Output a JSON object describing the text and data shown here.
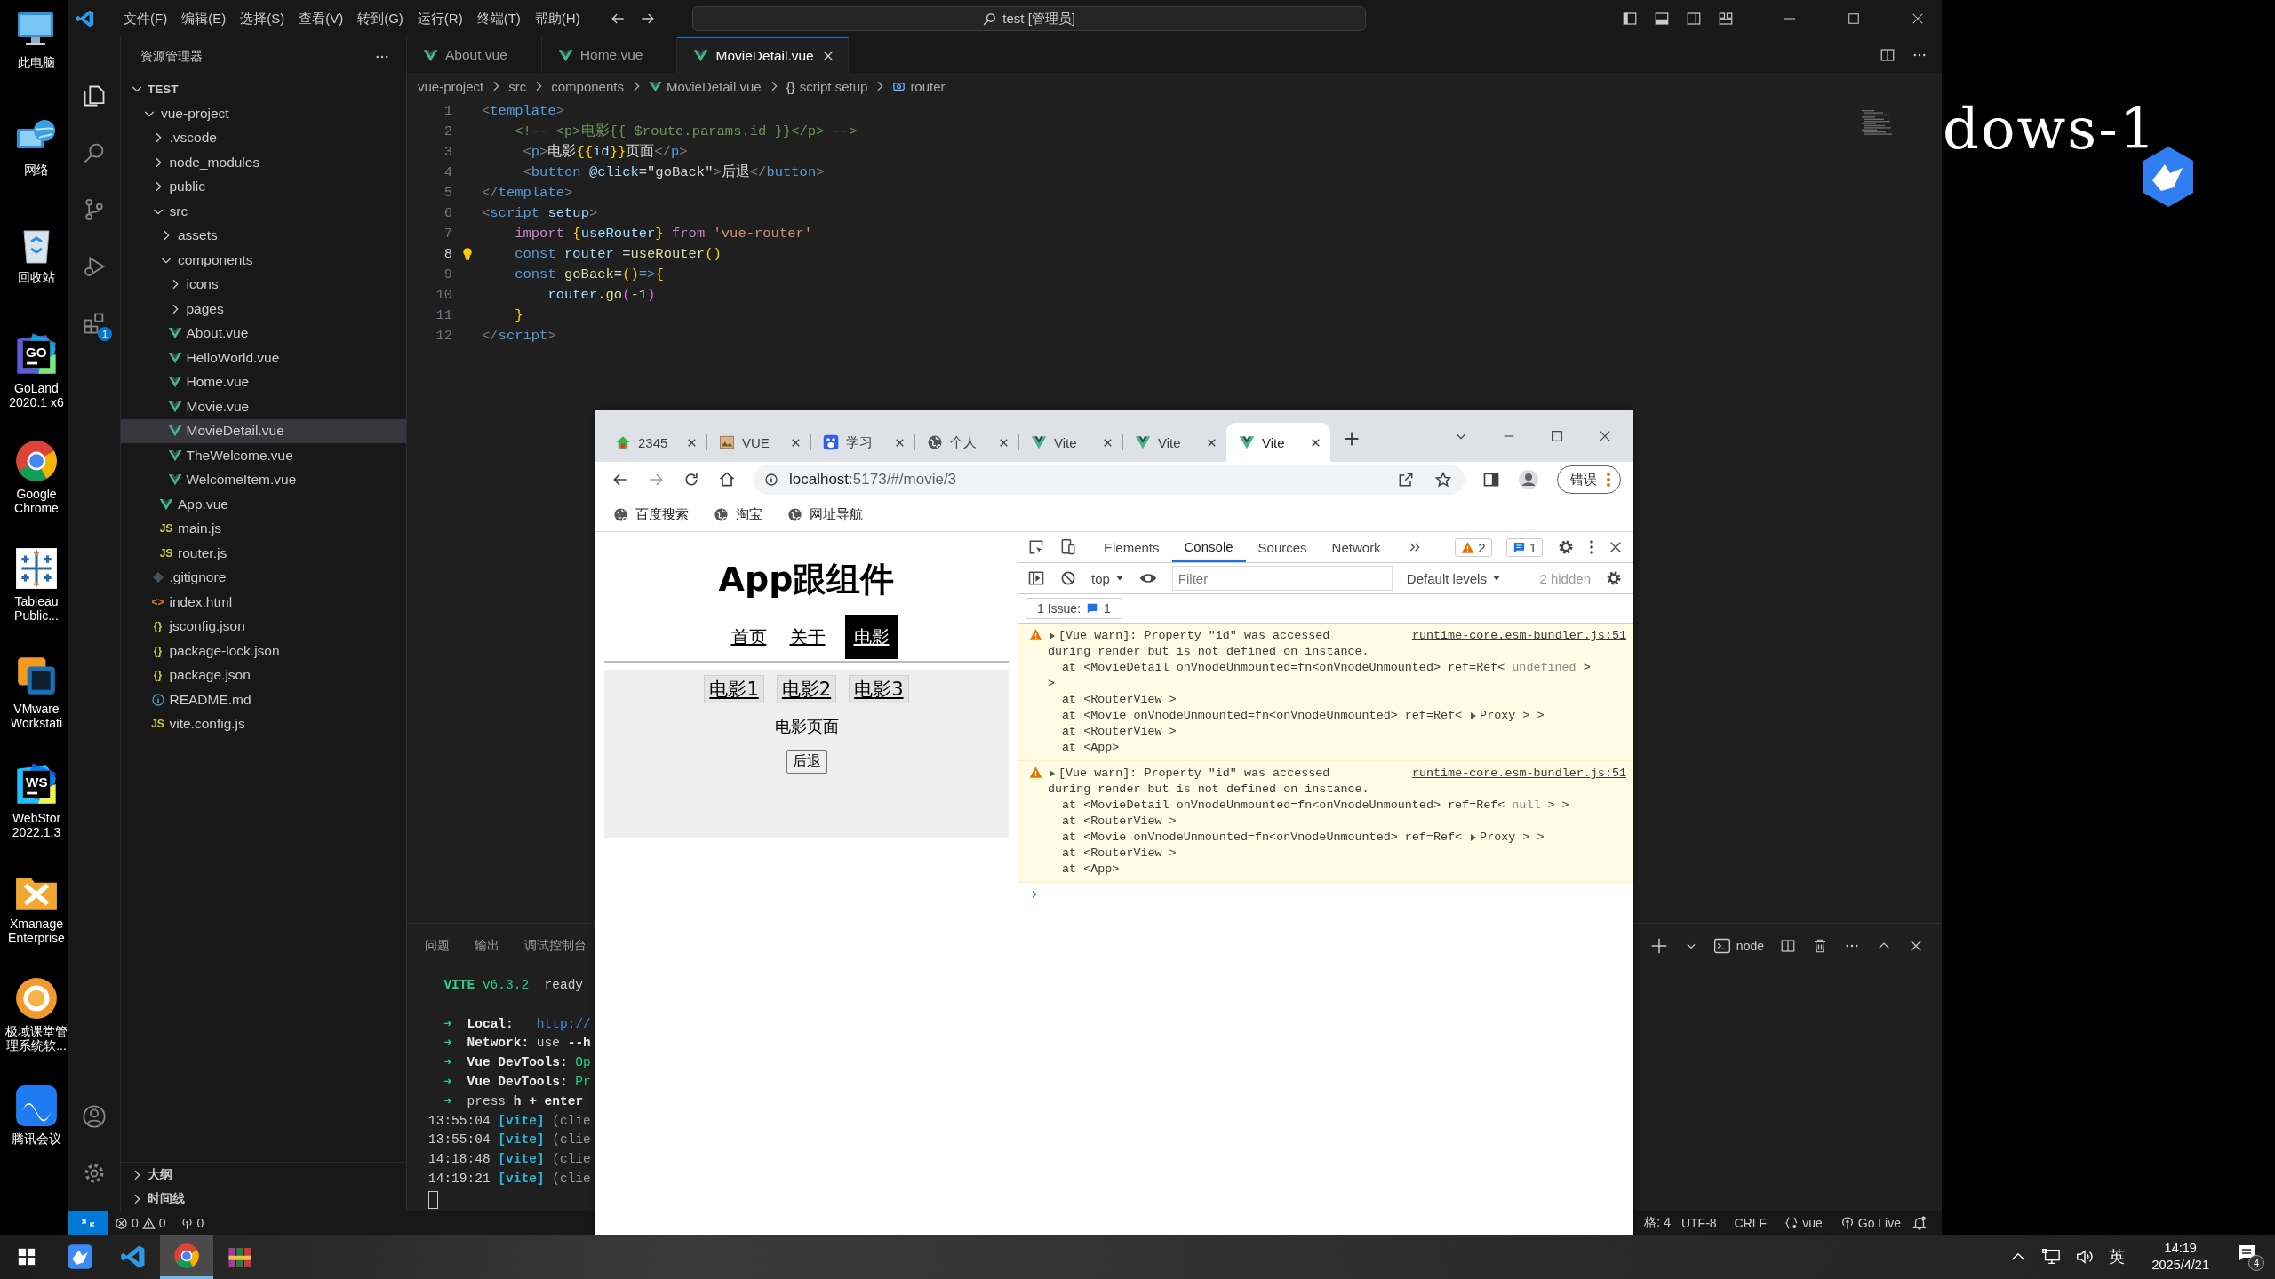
{
  "desktop": {
    "icons": [
      {
        "label": "此电脑",
        "kind": "computer"
      },
      {
        "label": "网络",
        "kind": "network"
      },
      {
        "label": "回收站",
        "kind": "recycle"
      },
      {
        "label": "GoLand 2020.1 x6",
        "kind": "goland",
        "glyph": "GO"
      },
      {
        "label": "Google Chrome",
        "kind": "chrome"
      },
      {
        "label": "Tableau Public...",
        "kind": "tableau"
      },
      {
        "label": "VMware Workstati",
        "kind": "vmware"
      },
      {
        "label": "WebStor 2022.1.3",
        "kind": "webstorm",
        "glyph": "WS"
      },
      {
        "label": "Xmanage Enterprise",
        "kind": "xmanager"
      },
      {
        "label": "极域课堂管理系统软...",
        "kind": "jiyu"
      },
      {
        "label": "腾讯会议",
        "kind": "meeting"
      }
    ],
    "backdrop_text": "dows-1"
  },
  "vscode": {
    "menu": [
      "文件(F)",
      "编辑(E)",
      "选择(S)",
      "查看(V)",
      "转到(G)",
      "运行(R)",
      "终端(T)",
      "帮助(H)"
    ],
    "command_center": "test [管理员]",
    "extensions_badge": "1",
    "explorer": {
      "title": "资源管理器",
      "root": "TEST",
      "tree": [
        {
          "name": "vue-project",
          "kind": "folder",
          "expanded": true,
          "selected": false,
          "children": [
            {
              "name": ".vscode",
              "kind": "folder",
              "expanded": false,
              "selected": false
            },
            {
              "name": "node_modules",
              "kind": "folder",
              "expanded": false,
              "selected": false
            },
            {
              "name": "public",
              "kind": "folder",
              "expanded": false,
              "selected": false
            },
            {
              "name": "src",
              "kind": "folder",
              "expanded": true,
              "selected": false,
              "children": [
                {
                  "name": "assets",
                  "kind": "folder",
                  "expanded": false,
                  "selected": false
                },
                {
                  "name": "components",
                  "kind": "folder",
                  "expanded": true,
                  "selected": false,
                  "children": [
                    {
                      "name": "icons",
                      "kind": "folder",
                      "expanded": false,
                      "selected": false
                    },
                    {
                      "name": "pages",
                      "kind": "folder",
                      "expanded": false,
                      "selected": false
                    },
                    {
                      "name": "About.vue",
                      "kind": "vue",
                      "selected": false
                    },
                    {
                      "name": "HelloWorld.vue",
                      "kind": "vue",
                      "selected": false
                    },
                    {
                      "name": "Home.vue",
                      "kind": "vue",
                      "selected": false
                    },
                    {
                      "name": "Movie.vue",
                      "kind": "vue",
                      "selected": false
                    },
                    {
                      "name": "MovieDetail.vue",
                      "kind": "vue",
                      "selected": true
                    },
                    {
                      "name": "TheWelcome.vue",
                      "kind": "vue",
                      "selected": false
                    },
                    {
                      "name": "WelcomeItem.vue",
                      "kind": "vue",
                      "selected": false
                    }
                  ]
                },
                {
                  "name": "App.vue",
                  "kind": "vue",
                  "selected": false
                },
                {
                  "name": "main.js",
                  "kind": "js",
                  "glyph": "JS",
                  "selected": false
                },
                {
                  "name": "router.js",
                  "kind": "js",
                  "glyph": "JS",
                  "selected": false
                }
              ]
            },
            {
              "name": ".gitignore",
              "kind": "git",
              "selected": false
            },
            {
              "name": "index.html",
              "kind": "html",
              "glyph": "<>",
              "selected": false
            },
            {
              "name": "jsconfig.json",
              "kind": "json",
              "glyph": "{}",
              "selected": false
            },
            {
              "name": "package-lock.json",
              "kind": "json",
              "glyph": "{}",
              "selected": false
            },
            {
              "name": "package.json",
              "kind": "json",
              "glyph": "{}",
              "selected": false
            },
            {
              "name": "README.md",
              "kind": "info",
              "selected": false
            },
            {
              "name": "vite.config.js",
              "kind": "js",
              "glyph": "JS",
              "selected": false
            }
          ]
        }
      ],
      "sections": [
        "大纲",
        "时间线"
      ]
    },
    "tabs": [
      {
        "label": "About.vue",
        "selected": false
      },
      {
        "label": "Home.vue",
        "selected": false
      },
      {
        "label": "MovieDetail.vue",
        "selected": true
      }
    ],
    "breadcrumbs": [
      {
        "label": "vue-project",
        "kind": "text"
      },
      {
        "label": "src",
        "kind": "text"
      },
      {
        "label": "components",
        "kind": "text"
      },
      {
        "label": "MovieDetail.vue",
        "kind": "vue"
      },
      {
        "label": "script setup",
        "kind": "braces",
        "glyph": "{}"
      },
      {
        "label": "router",
        "kind": "symbol"
      }
    ],
    "code": [
      {
        "number": "1",
        "current": false,
        "tokens": [
          {
            "text": "<",
            "kind": "bracket"
          },
          {
            "text": "template",
            "kind": "tag"
          },
          {
            "text": ">",
            "kind": "bracket"
          }
        ]
      },
      {
        "number": "2",
        "current": false,
        "tokens": [
          {
            "text": "    <!-- <p>电影{{ $route.params.id }}</p> -->",
            "kind": "comment"
          }
        ]
      },
      {
        "number": "3",
        "current": false,
        "tokens": [
          {
            "text": "     <",
            "kind": "bracket"
          },
          {
            "text": "p",
            "kind": "tag"
          },
          {
            "text": ">",
            "kind": "bracket"
          },
          {
            "text": "电影",
            "kind": "text"
          },
          {
            "text": "{{",
            "kind": "brace"
          },
          {
            "text": "id",
            "kind": "variable"
          },
          {
            "text": "}}",
            "kind": "brace"
          },
          {
            "text": "页面",
            "kind": "text"
          },
          {
            "text": "</",
            "kind": "bracket"
          },
          {
            "text": "p",
            "kind": "tag"
          },
          {
            "text": ">",
            "kind": "bracket"
          }
        ]
      },
      {
        "number": "4",
        "current": false,
        "tokens": [
          {
            "text": "     <",
            "kind": "bracket"
          },
          {
            "text": "button",
            "kind": "tag"
          },
          {
            "text": " @click",
            "kind": "attr"
          },
          {
            "text": "=\"goBack\"",
            "kind": "text"
          },
          {
            "text": ">",
            "kind": "bracket"
          },
          {
            "text": "后退",
            "kind": "text"
          },
          {
            "text": "</",
            "kind": "bracket"
          },
          {
            "text": "button",
            "kind": "tag"
          },
          {
            "text": ">",
            "kind": "bracket"
          }
        ]
      },
      {
        "number": "5",
        "current": false,
        "tokens": [
          {
            "text": "</",
            "kind": "bracket"
          },
          {
            "text": "template",
            "kind": "tag"
          },
          {
            "text": ">",
            "kind": "bracket"
          }
        ]
      },
      {
        "number": "6",
        "current": false,
        "tokens": [
          {
            "text": "<",
            "kind": "bracket"
          },
          {
            "text": "script",
            "kind": "tag"
          },
          {
            "text": " setup",
            "kind": "attr"
          },
          {
            "text": ">",
            "kind": "bracket"
          }
        ]
      },
      {
        "number": "7",
        "current": false,
        "tokens": [
          {
            "text": "    import ",
            "kind": "control"
          },
          {
            "text": "{",
            "kind": "brace"
          },
          {
            "text": "useRouter",
            "kind": "variable"
          },
          {
            "text": "}",
            "kind": "brace"
          },
          {
            "text": " from",
            "kind": "control"
          },
          {
            "text": " 'vue-router'",
            "kind": "string"
          }
        ]
      },
      {
        "number": "8",
        "current": true,
        "tokens": [
          {
            "text": "    const",
            "kind": "keyword"
          },
          {
            "text": " router",
            "kind": "variable"
          },
          {
            "text": " =",
            "kind": "text"
          },
          {
            "text": "useRouter",
            "kind": "function"
          },
          {
            "text": "()",
            "kind": "brace"
          }
        ]
      },
      {
        "number": "9",
        "current": false,
        "tokens": [
          {
            "text": "    const",
            "kind": "keyword"
          },
          {
            "text": " goBack",
            "kind": "function"
          },
          {
            "text": "=",
            "kind": "text"
          },
          {
            "text": "()",
            "kind": "brace"
          },
          {
            "text": "=>",
            "kind": "keyword"
          },
          {
            "text": "{",
            "kind": "brace"
          }
        ]
      },
      {
        "number": "10",
        "current": false,
        "tokens": [
          {
            "text": "        router",
            "kind": "variable"
          },
          {
            "text": ".",
            "kind": "text"
          },
          {
            "text": "go",
            "kind": "function"
          },
          {
            "text": "(",
            "kind": "paren"
          },
          {
            "text": "-1",
            "kind": "number"
          },
          {
            "text": ")",
            "kind": "paren"
          }
        ]
      },
      {
        "number": "11",
        "current": false,
        "tokens": [
          {
            "text": "    }",
            "kind": "brace"
          }
        ]
      },
      {
        "number": "12",
        "current": false,
        "tokens": [
          {
            "text": "</",
            "kind": "bracket"
          },
          {
            "text": "script",
            "kind": "tag"
          },
          {
            "text": ">",
            "kind": "bracket"
          }
        ]
      }
    ],
    "panel": {
      "tabs": [
        "问题",
        "输出",
        "调试控制台"
      ],
      "terminal_name": "node",
      "banner": [
        {
          "text": "  VITE",
          "kind": "accent-bold"
        },
        {
          "text": " v6.3.2",
          "kind": "accent"
        },
        {
          "text": "  ready",
          "kind": "plain"
        }
      ],
      "terminal": [
        [
          {
            "text": "  ➜ ",
            "kind": "accent"
          },
          {
            "text": " Local:",
            "kind": "bold"
          },
          {
            "text": "   http://",
            "kind": "link"
          }
        ],
        [
          {
            "text": "  ➜ ",
            "kind": "accent"
          },
          {
            "text": " Network:",
            "kind": "bold"
          },
          {
            "text": " use ",
            "kind": "plain"
          },
          {
            "text": "--h",
            "kind": "bold"
          }
        ],
        [
          {
            "text": "  ➜ ",
            "kind": "accent"
          },
          {
            "text": " Vue DevTools:",
            "kind": "bold"
          },
          {
            "text": " Op",
            "kind": "accent"
          }
        ],
        [
          {
            "text": "  ➜ ",
            "kind": "accent"
          },
          {
            "text": " Vue DevTools:",
            "kind": "bold"
          },
          {
            "text": " Pr",
            "kind": "accent"
          }
        ],
        [
          {
            "text": "  ➜ ",
            "kind": "accent"
          },
          {
            "text": " press ",
            "kind": "plain"
          },
          {
            "text": "h + enter",
            "kind": "bold"
          }
        ],
        [
          {
            "text": "13:55:04 ",
            "kind": "plain"
          },
          {
            "text": "[vite]",
            "kind": "tag"
          },
          {
            "text": " (clie",
            "kind": "dim"
          }
        ],
        [
          {
            "text": "13:55:04 ",
            "kind": "plain"
          },
          {
            "text": "[vite]",
            "kind": "tag"
          },
          {
            "text": " (clie",
            "kind": "dim"
          }
        ],
        [
          {
            "text": "14:18:48 ",
            "kind": "plain"
          },
          {
            "text": "[vite]",
            "kind": "tag"
          },
          {
            "text": " (clie",
            "kind": "dim"
          }
        ],
        [
          {
            "text": "14:19:21 ",
            "kind": "plain"
          },
          {
            "text": "[vite]",
            "kind": "tag"
          },
          {
            "text": " (clie",
            "kind": "dim"
          }
        ]
      ]
    },
    "status": {
      "errors": "0",
      "warnings": "0",
      "ports": "0",
      "right": [
        {
          "label": "格: 4",
          "kind": "text"
        },
        {
          "label": "UTF-8",
          "kind": "text"
        },
        {
          "label": "CRLF",
          "kind": "text"
        },
        {
          "label": "vue",
          "kind": "language"
        },
        {
          "label": "Go Live",
          "kind": "live"
        }
      ]
    }
  },
  "browser": {
    "tabs": [
      {
        "title": "2345",
        "kind": "house",
        "selected": false
      },
      {
        "title": "VUE",
        "kind": "image",
        "selected": false
      },
      {
        "title": "学习",
        "kind": "paw",
        "selected": false
      },
      {
        "title": "个人",
        "kind": "globe",
        "selected": false
      },
      {
        "title": "Vite",
        "kind": "vue",
        "selected": false
      },
      {
        "title": "Vite",
        "kind": "vue",
        "selected": false
      },
      {
        "title": "Vite",
        "kind": "vue",
        "selected": true
      }
    ],
    "url_host": "localhost",
    "url_rest": ":5173/#/movie/3",
    "profile_label": "错误",
    "bookmarks": [
      "百度搜索",
      "淘宝",
      "网址导航"
    ],
    "page": {
      "heading": "App跟组件",
      "nav": [
        {
          "label": "首页",
          "selected": false
        },
        {
          "label": "关于",
          "selected": false
        },
        {
          "label": "电影",
          "selected": true
        }
      ],
      "movies": [
        "电影1",
        "电影2",
        "电影3"
      ],
      "message": "电影页面",
      "back_button": "后退"
    },
    "devtools": {
      "tabs": [
        {
          "label": "Elements",
          "selected": false
        },
        {
          "label": "Console",
          "selected": true
        },
        {
          "label": "Sources",
          "selected": false
        },
        {
          "label": "Network",
          "selected": false
        }
      ],
      "warning_count": "2",
      "message_count": "1",
      "context": "top",
      "filter_placeholder": "Filter",
      "levels": "Default levels",
      "hidden": "2 hidden",
      "issues_label": "1 Issue:",
      "issues_count": "1",
      "messages": [
        {
          "kind": "warning",
          "source": "runtime-core.esm-bundler.js:51",
          "lines": [
            [
              {
                "text": "[Vue warn]: Property \"id\" was accessed",
                "kind": "plain"
              }
            ],
            [
              {
                "text": "during render but is not defined on instance.",
                "kind": "plain"
              }
            ],
            [
              {
                "text": "  at <MovieDetail onVnodeUnmounted=fn<onVnodeUnmounted> ref=Ref< ",
                "kind": "plain"
              },
              {
                "text": "undefined",
                "kind": "dim"
              },
              {
                "text": " >",
                "kind": "plain"
              }
            ],
            [
              {
                "text": ">",
                "kind": "plain"
              }
            ],
            [
              {
                "text": "  at <RouterView >",
                "kind": "plain"
              }
            ],
            [
              {
                "text": "  at <Movie onVnodeUnmounted=fn<onVnodeUnmounted> ref=Ref< ",
                "kind": "plain"
              },
              {
                "text": "Proxy",
                "kind": "object"
              },
              {
                "text": " > >",
                "kind": "plain"
              }
            ],
            [
              {
                "text": "  at <RouterView >",
                "kind": "plain"
              }
            ],
            [
              {
                "text": "  at <App>",
                "kind": "plain"
              }
            ]
          ]
        },
        {
          "kind": "warning",
          "source": "runtime-core.esm-bundler.js:51",
          "lines": [
            [
              {
                "text": "[Vue warn]: Property \"id\" was accessed",
                "kind": "plain"
              }
            ],
            [
              {
                "text": "during render but is not defined on instance.",
                "kind": "plain"
              }
            ],
            [
              {
                "text": "  at <MovieDetail onVnodeUnmounted=fn<onVnodeUnmounted> ref=Ref< ",
                "kind": "plain"
              },
              {
                "text": "null",
                "kind": "dim"
              },
              {
                "text": " > >",
                "kind": "plain"
              }
            ],
            [
              {
                "text": "  at <RouterView >",
                "kind": "plain"
              }
            ],
            [
              {
                "text": "  at <Movie onVnodeUnmounted=fn<onVnodeUnmounted> ref=Ref< ",
                "kind": "plain"
              },
              {
                "text": "Proxy",
                "kind": "object"
              },
              {
                "text": " > >",
                "kind": "plain"
              }
            ],
            [
              {
                "text": "  at <RouterView >",
                "kind": "plain"
              }
            ],
            [
              {
                "text": "  at <App>",
                "kind": "plain"
              }
            ]
          ]
        }
      ]
    }
  },
  "taskbar": {
    "apps": [
      {
        "kind": "bird",
        "selected": false
      },
      {
        "kind": "editor",
        "selected": false
      },
      {
        "kind": "chrome",
        "selected": true
      },
      {
        "kind": "archive",
        "selected": false
      }
    ],
    "ime": "英",
    "time": "14:19",
    "date": "2025/4/21",
    "notifications": "4"
  }
}
